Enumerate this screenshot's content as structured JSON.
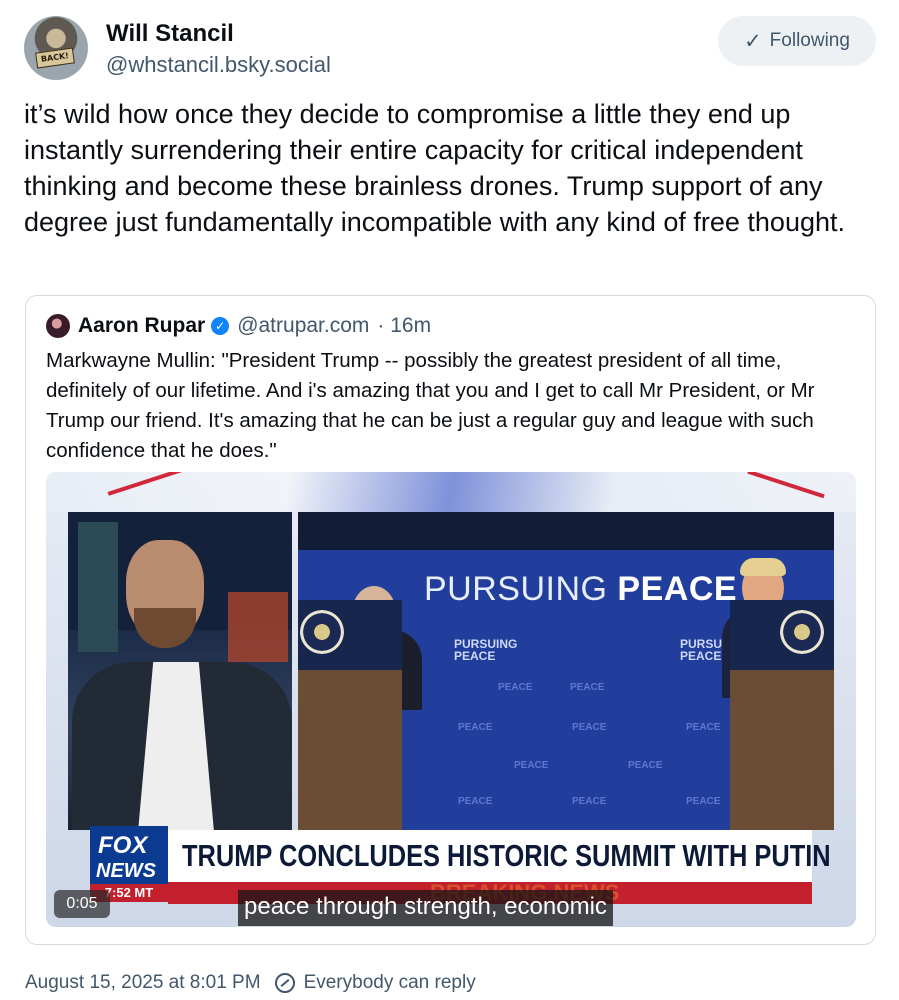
{
  "author": {
    "name": "Will Stancil",
    "handle": "@whstancil.bsky.social",
    "avatar_sign": "BACK!"
  },
  "follow_button": {
    "label": "Following",
    "icon": "check-icon"
  },
  "post": {
    "text": "it’s wild how once they decide to compromise a little they end up instantly surrendering their entire capacity for critical independent thinking and become these brainless drones. Trump support of any degree just fundamentally incompatible with any kind of free thought."
  },
  "quoted_post": {
    "author_name": "Aaron Rupar",
    "verified": true,
    "handle": "@atrupar.com",
    "time": "· 16m",
    "text": "Markwayne Mullin: \"President Trump -- possibly the greatest president of all time, definitely of our lifetime. And i's amazing that you and I get to call Mr President, or Mr Trump our friend. It's amazing that he can be just a regular guy and league with such confidence that he does.\"",
    "video": {
      "timestamp": "0:05",
      "caption": "peace through strength, economic",
      "backdrop_banner_light": "PURSUING ",
      "backdrop_banner_bold": "PEACE",
      "podium_label": "PURSUING PEACE",
      "lower_third": {
        "logo_top": "FOX",
        "logo_bottom": "NEWS",
        "clock": "7:52 MT",
        "headline": "TRUMP CONCLUDES HISTORIC SUMMIT WITH PUTIN",
        "ticker": "BREAKING NEWS"
      }
    }
  },
  "footer": {
    "date": "August 15, 2025 at 8:01 PM",
    "reply_setting": "Everybody can reply"
  },
  "colors": {
    "text_primary": "#0b0f14",
    "text_secondary": "#42576c",
    "button_bg": "#eef1f4",
    "verified_blue": "#1083fe",
    "border": "#d4dbe2"
  }
}
